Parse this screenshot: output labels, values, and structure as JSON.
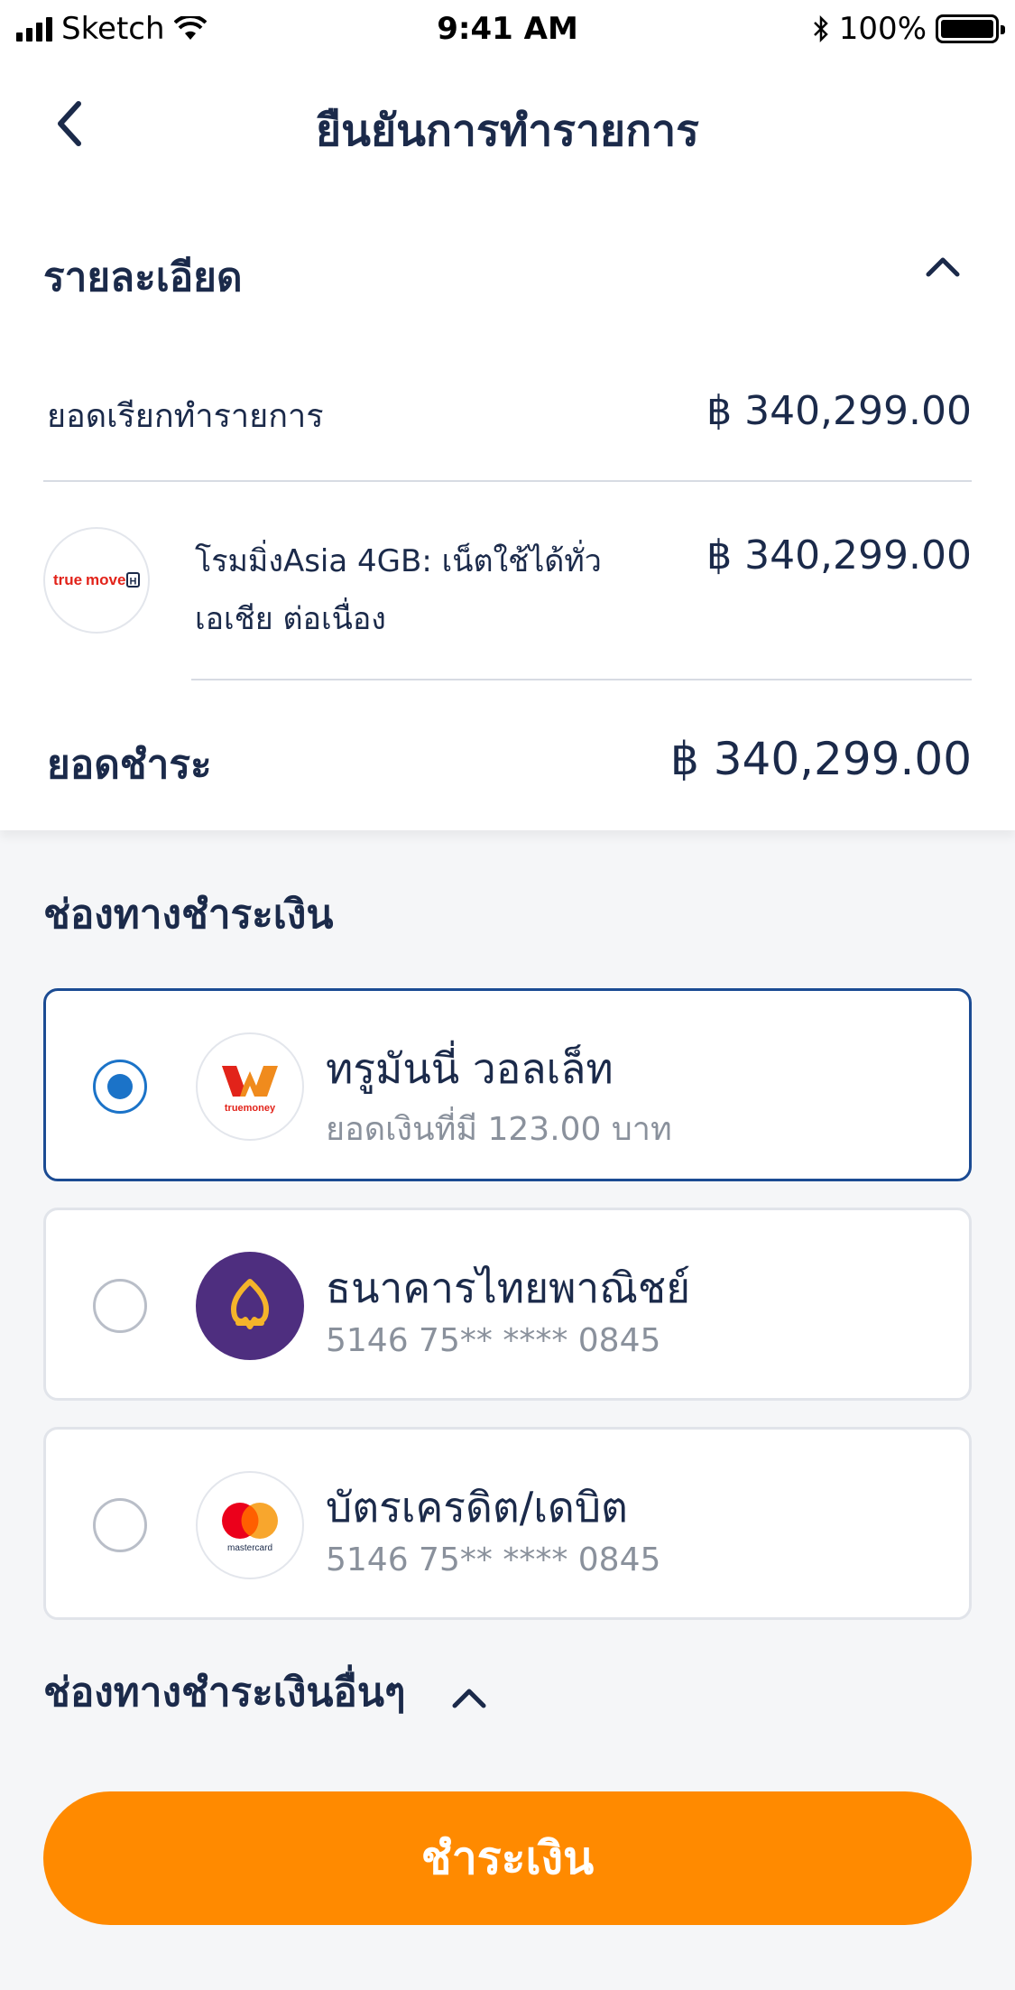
{
  "status_bar": {
    "carrier": "Sketch",
    "time": "9:41 AM",
    "battery": "100%"
  },
  "header": {
    "title": "ยืนยันการทำรายการ"
  },
  "details": {
    "section_title": "รายละเอียด",
    "request_label": "ยอดเรียกทำรายการ",
    "request_amount": "฿ 340,299.00",
    "product_line1": "โรมมิ่งAsia 4GB: เน็ตใช้ได้ทั่ว",
    "product_line2": "เอเชีย ต่อเนื่อง",
    "product_amount": "฿ 340,299.00",
    "product_logo_text": "truemove H",
    "total_label": "ยอดชำระ",
    "total_amount": "฿ 340,299.00"
  },
  "payment": {
    "section_title": "ช่องทางชำระเงิน",
    "methods": [
      {
        "name": "ทรูมันนี่ วอลเล็ท",
        "detail": "ยอดเงินที่มี 123.00 บาท",
        "logo_text": "truemoney",
        "selected": true
      },
      {
        "name": "ธนาคารไทยพาณิชย์",
        "detail": "5146 75** **** 0845",
        "selected": false
      },
      {
        "name": "บัตรเครดิต/เดบิต",
        "detail": "5146 75** **** 0845",
        "logo_text": "mastercard",
        "selected": false
      }
    ],
    "other_label": "ช่องทางชำระเงินอื่นๆ"
  },
  "pay_button_label": "ชำระเงิน",
  "colors": {
    "accent": "#ff8a00",
    "selected_border": "#1b4b93",
    "radio": "#1b73c8",
    "scb_purple": "#4e2e7f"
  },
  "icons": [
    "back-chevron-icon",
    "chevron-up-icon",
    "wifi-icon",
    "bluetooth-icon",
    "battery-icon"
  ]
}
